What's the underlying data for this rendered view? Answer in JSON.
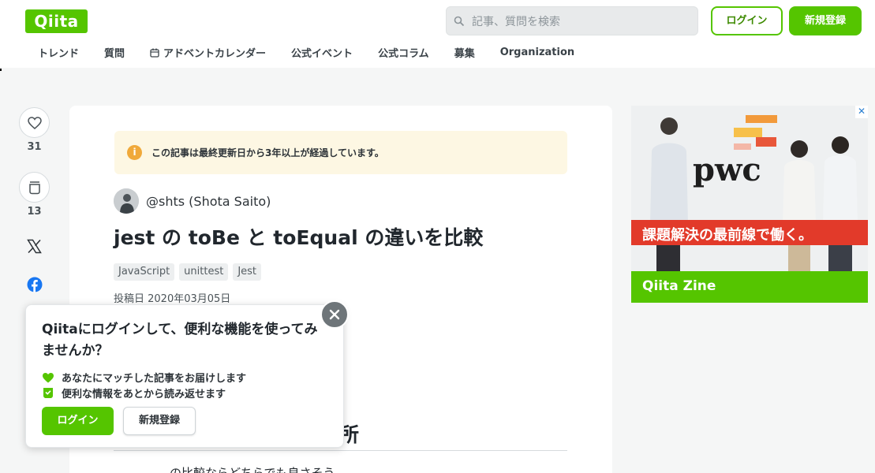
{
  "header": {
    "logo_text": "Qiita",
    "search_placeholder": "記事、質問を検索",
    "login_label": "ログイン",
    "signup_label": "新規登録"
  },
  "nav": {
    "items": [
      "トレンド",
      "質問",
      "アドベントカレンダー",
      "公式イベント",
      "公式コラム",
      "募集",
      "Organization"
    ]
  },
  "actions": {
    "like_count": "31",
    "stock_count": "13"
  },
  "article": {
    "notice": "この記事は最終更新日から3年以上が経過しています。",
    "author": "@shts (Shota Saito)",
    "title": "jest の toBe と toEqual の違いを比較",
    "tags": [
      "JavaScript",
      "unittest",
      "Jest"
    ],
    "posted": "投稿日 2020年03月05日",
    "heading_partial": "所",
    "body_partial": "…の比較ならどちらでも良さそう"
  },
  "ad": {
    "brand": "pwc",
    "catch": "課題解決の最前線で働く。",
    "footer": "Qiita Zine",
    "close": "✕"
  },
  "popup": {
    "title": "Qiitaにログインして、便利な機能を使ってみませんか？",
    "features": [
      "あなたにマッチした記事をお届けします",
      "便利な情報をあとから読み返せます"
    ],
    "login_label": "ログイン",
    "signup_label": "新規登録"
  },
  "colors": {
    "brand": "#55c500",
    "notice_bg": "#fdf7e3",
    "notice_icon": "#f0a93a",
    "ad_band": "#e23a2a"
  }
}
